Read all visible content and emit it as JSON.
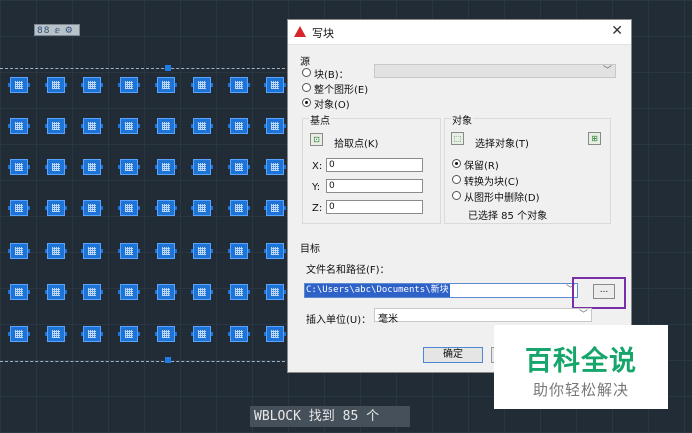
{
  "toolbar": {
    "icons_text": "88 ⅇ ⚙"
  },
  "dialog": {
    "title": "写块",
    "source": {
      "label": "源",
      "block_label": "块(B)：",
      "entire_drawing_label": "整个图形(E)",
      "objects_label": "对象(O)",
      "selected_option": "objects"
    },
    "base_point": {
      "label": "基点",
      "pick_label": "拾取点(K)",
      "x_label": "X:",
      "y_label": "Y:",
      "z_label": "Z:",
      "x": "0",
      "y": "0",
      "z": "0"
    },
    "objects": {
      "label": "对象",
      "select_label": "选择对象(T)",
      "retain_label": "保留(R)",
      "convert_label": "转换为块(C)",
      "delete_label": "从图形中删除(D)",
      "selected_option": "retain",
      "status": "已选择 85 个对象"
    },
    "destination": {
      "label": "目标",
      "path_label": "文件名和路径(F)：",
      "path_value": "C:\\Users\\abc\\Documents\\新块",
      "browse_label": "...",
      "units_label": "插入单位(U)：",
      "units_value": "毫米"
    },
    "ok_label": "确定"
  },
  "command_line": "WBLOCK 找到 85 个",
  "watermark": {
    "title": "百科全说",
    "subtitle": "助你轻松解决"
  },
  "colors": {
    "block_fill": "#1d74d6",
    "highlight": "#7a2ea8",
    "watermark_green": "#16a56b"
  }
}
